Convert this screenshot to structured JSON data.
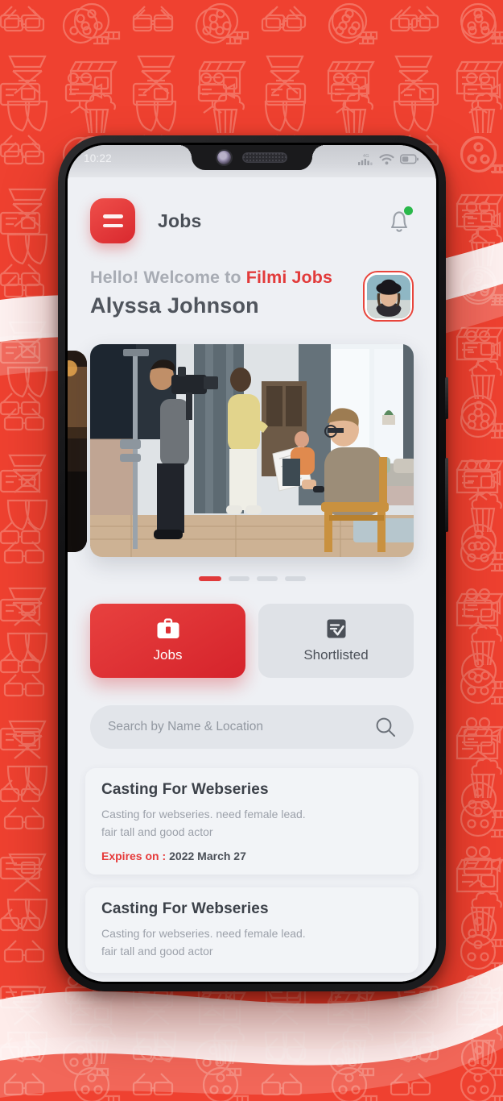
{
  "background": {
    "color": "#ef4130",
    "pattern_icons": [
      "3d-glasses-icon",
      "film-reel-icon",
      "director-chair-icon",
      "theater-masks-icon",
      "clapperboard-icon",
      "popcorn-icon",
      "movie-camera-icon",
      "ticket-icon"
    ]
  },
  "statusbar": {
    "time": "10:22",
    "network": "4G",
    "icons": [
      "signal-icon",
      "wifi-icon",
      "battery-icon"
    ]
  },
  "appbar": {
    "menu_icon": "hamburger-menu-icon",
    "title": "Jobs",
    "bell_icon": "notification-bell-icon",
    "has_notification": true
  },
  "greeting": {
    "welcome_prefix": "Hello! Welcome to ",
    "brand": "Filmi Jobs",
    "user_name": "Alyssa Johnson",
    "avatar_alt": "user-avatar"
  },
  "carousel": {
    "slide_alt": "film-set-photo",
    "total_slides": 4,
    "active_index": 0
  },
  "tabs": [
    {
      "key": "jobs",
      "label": "Jobs",
      "icon": "briefcase-icon",
      "active": true
    },
    {
      "key": "shortlisted",
      "label": "Shortlisted",
      "icon": "checklist-icon",
      "active": false
    }
  ],
  "search": {
    "placeholder": "Search by Name & Location",
    "value": "",
    "icon": "search-icon"
  },
  "jobs": [
    {
      "title": "Casting For Webseries",
      "description_line1": "Casting for webseries. need female lead.",
      "description_line2": "fair tall and good actor",
      "expiry_label": "Expires on :",
      "expiry_date": "2022 March 27"
    },
    {
      "title": "Casting For Webseries",
      "description_line1": "Casting for webseries. need female lead.",
      "description_line2": "fair tall and good actor",
      "expiry_label": "",
      "expiry_date": ""
    }
  ],
  "colors": {
    "brand_red": "#e23b3b",
    "tab_active": "#d5232b",
    "notification_green": "#2ab84a",
    "screen_bg": "#eef0f4"
  }
}
